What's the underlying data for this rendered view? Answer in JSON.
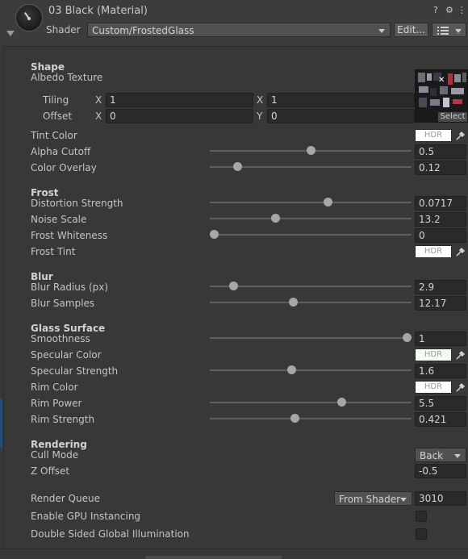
{
  "header": {
    "material_name": "03 Black (Material)",
    "shader_label": "Shader",
    "shader_value": "Custom/FrostedGlass",
    "edit_label": "Edit...",
    "help_glyph": "?",
    "settings_glyph": "⚙",
    "menu_glyph": "⋮"
  },
  "sections": {
    "shape": "Shape",
    "frost": "Frost",
    "blur": "Blur",
    "glass": "Glass Surface",
    "rendering": "Rendering"
  },
  "albedo": {
    "label": "Albedo Texture",
    "tiling_label": "Tiling",
    "offset_label": "Offset",
    "x_label": "X",
    "y_label": "Y",
    "tiling_x": "1",
    "tiling_y": "1",
    "offset_x": "0",
    "offset_y": "0",
    "select_label": "Select"
  },
  "props": {
    "tint_color": "Tint Color",
    "alpha_cutoff": "Alpha Cutoff",
    "alpha_cutoff_value": "0.5",
    "alpha_cutoff_fraction": 0.5,
    "color_overlay": "Color Overlay",
    "color_overlay_value": "0.12",
    "color_overlay_fraction": 0.12,
    "distortion_strength": "Distortion Strength",
    "distortion_strength_value": "0.0717",
    "distortion_strength_fraction": 0.59,
    "noise_scale": "Noise Scale",
    "noise_scale_value": "13.2",
    "noise_scale_fraction": 0.32,
    "frost_whiteness": "Frost Whiteness",
    "frost_whiteness_value": "0",
    "frost_whiteness_fraction": 0.0,
    "frost_tint": "Frost Tint",
    "blur_radius": "Blur Radius (px)",
    "blur_radius_value": "2.9",
    "blur_radius_fraction": 0.1,
    "blur_samples": "Blur Samples",
    "blur_samples_value": "12.17",
    "blur_samples_fraction": 0.41,
    "smoothness": "Smoothness",
    "smoothness_value": "1",
    "smoothness_fraction": 1.0,
    "specular_color": "Specular Color",
    "specular_strength": "Specular Strength",
    "specular_strength_value": "1.6",
    "specular_strength_fraction": 0.4,
    "rim_color": "Rim Color",
    "rim_power": "Rim Power",
    "rim_power_value": "5.5",
    "rim_power_fraction": 0.66,
    "rim_strength": "Rim Strength",
    "rim_strength_value": "0.421",
    "rim_strength_fraction": 0.42,
    "cull_mode": "Cull Mode",
    "cull_mode_value": "Back",
    "z_offset": "Z Offset",
    "z_offset_value": "-0.5",
    "render_queue": "Render Queue",
    "render_queue_source": "From Shader",
    "render_queue_value": "3010",
    "gpu_instancing": "Enable GPU Instancing",
    "double_sided_gi": "Double Sided Global Illumination",
    "hdr_label": "HDR"
  },
  "colors": {
    "tint_color": "#ffffff",
    "frost_tint": "#ffffff",
    "specular_color": "#f2fff2",
    "rim_color": "#ffffff"
  }
}
